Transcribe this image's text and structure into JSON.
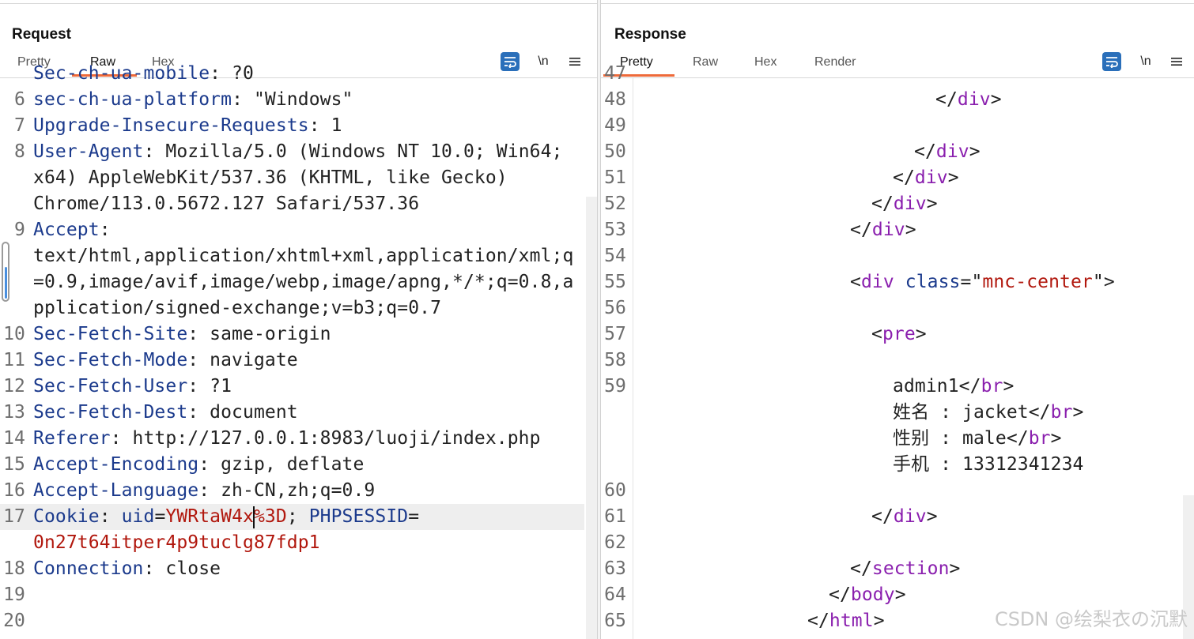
{
  "request": {
    "title": "Request",
    "tabs": [
      {
        "label": "Pretty",
        "active": false
      },
      {
        "label": "Raw",
        "active": true
      },
      {
        "label": "Hex",
        "active": false
      }
    ],
    "toolbar": {
      "newline_label": "\\n"
    },
    "lines": [
      {
        "n": "",
        "segs": [
          {
            "c": "k",
            "t": "Sec-ch-ua-mobile"
          },
          {
            "c": "v",
            "t": ": ?0"
          }
        ],
        "partial": true
      },
      {
        "n": "6",
        "segs": [
          {
            "c": "k",
            "t": "sec-ch-ua-platform"
          },
          {
            "c": "v",
            "t": ": \"Windows\""
          }
        ]
      },
      {
        "n": "7",
        "segs": [
          {
            "c": "k",
            "t": "Upgrade-Insecure-Requests"
          },
          {
            "c": "v",
            "t": ": 1"
          }
        ]
      },
      {
        "n": "8",
        "segs": [
          {
            "c": "k",
            "t": "User-Agent"
          },
          {
            "c": "v",
            "t": ": Mozilla/5.0 (Windows NT 10.0; Win64;"
          }
        ]
      },
      {
        "n": "",
        "segs": [
          {
            "c": "v",
            "t": "x64) AppleWebKit/537.36 (KHTML, like Gecko)"
          }
        ]
      },
      {
        "n": "",
        "segs": [
          {
            "c": "v",
            "t": "Chrome/113.0.5672.127 Safari/537.36"
          }
        ]
      },
      {
        "n": "9",
        "segs": [
          {
            "c": "k",
            "t": "Accept"
          },
          {
            "c": "v",
            "t": ":"
          }
        ]
      },
      {
        "n": "",
        "segs": [
          {
            "c": "v",
            "t": "text/html,application/xhtml+xml,application/xml;q"
          }
        ]
      },
      {
        "n": "",
        "segs": [
          {
            "c": "v",
            "t": "=0.9,image/avif,image/webp,image/apng,*/*;q=0.8,a"
          }
        ]
      },
      {
        "n": "",
        "segs": [
          {
            "c": "v",
            "t": "pplication/signed-exchange;v=b3;q=0.7"
          }
        ]
      },
      {
        "n": "10",
        "segs": [
          {
            "c": "k",
            "t": "Sec-Fetch-Site"
          },
          {
            "c": "v",
            "t": ": same-origin"
          }
        ]
      },
      {
        "n": "11",
        "segs": [
          {
            "c": "k",
            "t": "Sec-Fetch-Mode"
          },
          {
            "c": "v",
            "t": ": navigate"
          }
        ]
      },
      {
        "n": "12",
        "segs": [
          {
            "c": "k",
            "t": "Sec-Fetch-User"
          },
          {
            "c": "v",
            "t": ": ?1"
          }
        ]
      },
      {
        "n": "13",
        "segs": [
          {
            "c": "k",
            "t": "Sec-Fetch-Dest"
          },
          {
            "c": "v",
            "t": ": document"
          }
        ]
      },
      {
        "n": "14",
        "segs": [
          {
            "c": "k",
            "t": "Referer"
          },
          {
            "c": "v",
            "t": ": http://127.0.0.1:8983/luoji/index.php"
          }
        ]
      },
      {
        "n": "15",
        "segs": [
          {
            "c": "k",
            "t": "Accept-Encoding"
          },
          {
            "c": "v",
            "t": ": gzip, deflate"
          }
        ]
      },
      {
        "n": "16",
        "segs": [
          {
            "c": "k",
            "t": "Accept-Language"
          },
          {
            "c": "v",
            "t": ": zh-CN,zh;q=0.9"
          }
        ]
      },
      {
        "n": "17",
        "segs": [
          {
            "c": "k",
            "t": "Cookie"
          },
          {
            "c": "v",
            "t": ": "
          },
          {
            "c": "k",
            "t": "uid"
          },
          {
            "c": "v",
            "t": "="
          },
          {
            "c": "r",
            "t": "YWRtaW4x%3D"
          },
          {
            "c": "v",
            "t": "; "
          },
          {
            "c": "k",
            "t": "PHPSESSID"
          },
          {
            "c": "v",
            "t": "="
          }
        ],
        "highlight": true
      },
      {
        "n": "",
        "segs": [
          {
            "c": "r",
            "t": "0n27t64itper4p9tuclg87fdp1"
          }
        ]
      },
      {
        "n": "18",
        "segs": [
          {
            "c": "k",
            "t": "Connection"
          },
          {
            "c": "v",
            "t": ": close"
          }
        ]
      },
      {
        "n": "19",
        "segs": []
      },
      {
        "n": "20",
        "segs": []
      }
    ]
  },
  "response": {
    "title": "Response",
    "tabs": [
      {
        "label": "Pretty",
        "active": true
      },
      {
        "label": "Raw",
        "active": false
      },
      {
        "label": "Hex",
        "active": false
      },
      {
        "label": "Render",
        "active": false
      }
    ],
    "toolbar": {
      "newline_label": "\\n"
    },
    "lines": [
      {
        "n": "47",
        "segs": [],
        "partial": true
      },
      {
        "n": "48",
        "indent": 14,
        "segs": [
          {
            "c": "c",
            "t": "</"
          },
          {
            "c": "t",
            "t": "div"
          },
          {
            "c": "c",
            "t": ">"
          }
        ]
      },
      {
        "n": "49",
        "segs": []
      },
      {
        "n": "50",
        "indent": 13,
        "segs": [
          {
            "c": "c",
            "t": "</"
          },
          {
            "c": "t",
            "t": "div"
          },
          {
            "c": "c",
            "t": ">"
          }
        ]
      },
      {
        "n": "51",
        "indent": 12,
        "segs": [
          {
            "c": "c",
            "t": "</"
          },
          {
            "c": "t",
            "t": "div"
          },
          {
            "c": "c",
            "t": ">"
          }
        ]
      },
      {
        "n": "52",
        "indent": 11,
        "segs": [
          {
            "c": "c",
            "t": "</"
          },
          {
            "c": "t",
            "t": "div"
          },
          {
            "c": "c",
            "t": ">"
          }
        ]
      },
      {
        "n": "53",
        "indent": 10,
        "segs": [
          {
            "c": "c",
            "t": "</"
          },
          {
            "c": "t",
            "t": "div"
          },
          {
            "c": "c",
            "t": ">"
          }
        ]
      },
      {
        "n": "54",
        "segs": []
      },
      {
        "n": "55",
        "indent": 10,
        "segs": [
          {
            "c": "c",
            "t": "<"
          },
          {
            "c": "t",
            "t": "div"
          },
          {
            "c": "c",
            "t": " "
          },
          {
            "c": "a",
            "t": "class"
          },
          {
            "c": "c",
            "t": "=\""
          },
          {
            "c": "s",
            "t": "mnc-center"
          },
          {
            "c": "c",
            "t": "\">"
          }
        ]
      },
      {
        "n": "56",
        "segs": []
      },
      {
        "n": "57",
        "indent": 11,
        "segs": [
          {
            "c": "c",
            "t": "<"
          },
          {
            "c": "t",
            "t": "pre"
          },
          {
            "c": "c",
            "t": ">"
          }
        ]
      },
      {
        "n": "58",
        "segs": []
      },
      {
        "n": "59",
        "indent": 12,
        "segs": [
          {
            "c": "c",
            "t": "admin1</"
          },
          {
            "c": "t",
            "t": "br"
          },
          {
            "c": "c",
            "t": ">"
          }
        ]
      },
      {
        "n": "",
        "indent": 12,
        "segs": [
          {
            "c": "c",
            "t": "姓名 : jacket</"
          },
          {
            "c": "t",
            "t": "br"
          },
          {
            "c": "c",
            "t": ">"
          }
        ]
      },
      {
        "n": "",
        "indent": 12,
        "segs": [
          {
            "c": "c",
            "t": "性别 : male</"
          },
          {
            "c": "t",
            "t": "br"
          },
          {
            "c": "c",
            "t": ">"
          }
        ]
      },
      {
        "n": "",
        "indent": 12,
        "segs": [
          {
            "c": "c",
            "t": "手机 : 13312341234"
          }
        ]
      },
      {
        "n": "60",
        "segs": []
      },
      {
        "n": "61",
        "indent": 11,
        "segs": [
          {
            "c": "c",
            "t": "</"
          },
          {
            "c": "t",
            "t": "div"
          },
          {
            "c": "c",
            "t": ">"
          }
        ]
      },
      {
        "n": "62",
        "segs": []
      },
      {
        "n": "63",
        "indent": 10,
        "segs": [
          {
            "c": "c",
            "t": "</"
          },
          {
            "c": "t",
            "t": "section"
          },
          {
            "c": "c",
            "t": ">"
          }
        ]
      },
      {
        "n": "64",
        "indent": 9,
        "segs": [
          {
            "c": "c",
            "t": "</"
          },
          {
            "c": "t",
            "t": "body"
          },
          {
            "c": "c",
            "t": ">"
          }
        ]
      },
      {
        "n": "65",
        "indent": 8,
        "segs": [
          {
            "c": "c",
            "t": "</"
          },
          {
            "c": "t",
            "t": "html"
          },
          {
            "c": "c",
            "t": ">"
          }
        ]
      }
    ]
  },
  "watermark": "CSDN @绘梨衣の沉默",
  "colors": {
    "accent": "#ee6a3a",
    "button_blue": "#2a6fba",
    "key_blue": "#1b3a8c",
    "value_red": "#b1170d",
    "tag_purple": "#8a1fae"
  }
}
